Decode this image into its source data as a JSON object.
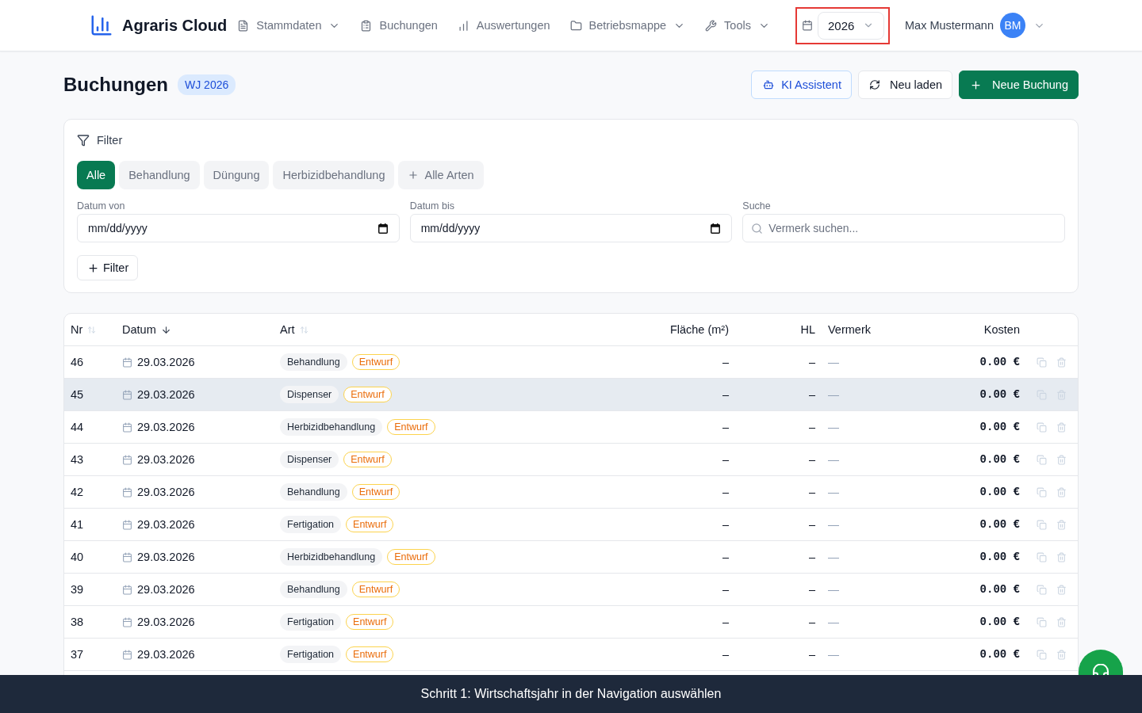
{
  "nav": {
    "app_name": "Agraris Cloud",
    "items": [
      {
        "label": "Stammdaten",
        "has_menu": true
      },
      {
        "label": "Buchungen",
        "has_menu": false
      },
      {
        "label": "Auswertungen",
        "has_menu": false
      },
      {
        "label": "Betriebsmappe",
        "has_menu": true
      },
      {
        "label": "Tools",
        "has_menu": true
      }
    ],
    "year_selector": {
      "value": "2026",
      "highlighted": true
    },
    "user": {
      "name": "Max Mustermann",
      "initials": "BM"
    }
  },
  "page_header": {
    "title": "Buchungen",
    "badge": "WJ 2026",
    "buttons": [
      {
        "label": "KI Assistent",
        "kind": "assistant"
      },
      {
        "label": "Neu laden",
        "kind": "reload"
      },
      {
        "label": "Neue Buchung",
        "kind": "primary"
      }
    ]
  },
  "filter": {
    "title": "Filter",
    "chips": [
      {
        "label": "Alle",
        "kind": "type",
        "selected": true
      },
      {
        "label": "Behandlung",
        "kind": "type",
        "selected": false
      },
      {
        "label": "Düngung",
        "kind": "type",
        "selected": false
      },
      {
        "label": "Herbizidbehandlung",
        "kind": "type",
        "selected": false
      },
      {
        "label": "Alle Arten",
        "kind": "more",
        "selected": false
      }
    ],
    "fields": [
      {
        "label": "Datum von",
        "kind": "date",
        "placeholder": "mm/dd/yyyy"
      },
      {
        "label": "Datum bis",
        "kind": "date",
        "placeholder": "mm/dd/yyyy"
      },
      {
        "label": "Suche",
        "kind": "search",
        "placeholder": "Vermerk suchen..."
      }
    ],
    "add_button": "Filter"
  },
  "table": {
    "columns": [
      {
        "label": "Nr",
        "sortable": true,
        "sorted": false
      },
      {
        "label": "Datum",
        "sortable": true,
        "sorted": true
      },
      {
        "label": "Art",
        "sortable": true,
        "sorted": false
      },
      {
        "label": "Fläche (m²)",
        "sortable": false,
        "sorted": false
      },
      {
        "label": "HL",
        "sortable": false,
        "sorted": false
      },
      {
        "label": "Vermerk",
        "sortable": false,
        "sorted": false
      },
      {
        "label": "Kosten",
        "sortable": false,
        "sorted": false
      }
    ],
    "rows": [
      {
        "nr": "46",
        "date": "29.03.2026",
        "type": "Behandlung",
        "status": "Entwurf",
        "area": "–",
        "hl": "–",
        "note": "—",
        "cost": "0.00 €",
        "highlighted": false
      },
      {
        "nr": "45",
        "date": "29.03.2026",
        "type": "Dispenser",
        "status": "Entwurf",
        "area": "–",
        "hl": "–",
        "note": "—",
        "cost": "0.00 €",
        "highlighted": true
      },
      {
        "nr": "44",
        "date": "29.03.2026",
        "type": "Herbizidbehandlung",
        "status": "Entwurf",
        "area": "–",
        "hl": "–",
        "note": "—",
        "cost": "0.00 €",
        "highlighted": false
      },
      {
        "nr": "43",
        "date": "29.03.2026",
        "type": "Dispenser",
        "status": "Entwurf",
        "area": "–",
        "hl": "–",
        "note": "—",
        "cost": "0.00 €",
        "highlighted": false
      },
      {
        "nr": "42",
        "date": "29.03.2026",
        "type": "Behandlung",
        "status": "Entwurf",
        "area": "–",
        "hl": "–",
        "note": "—",
        "cost": "0.00 €",
        "highlighted": false
      },
      {
        "nr": "41",
        "date": "29.03.2026",
        "type": "Fertigation",
        "status": "Entwurf",
        "area": "–",
        "hl": "–",
        "note": "—",
        "cost": "0.00 €",
        "highlighted": false
      },
      {
        "nr": "40",
        "date": "29.03.2026",
        "type": "Herbizidbehandlung",
        "status": "Entwurf",
        "area": "–",
        "hl": "–",
        "note": "—",
        "cost": "0.00 €",
        "highlighted": false
      },
      {
        "nr": "39",
        "date": "29.03.2026",
        "type": "Behandlung",
        "status": "Entwurf",
        "area": "–",
        "hl": "–",
        "note": "—",
        "cost": "0.00 €",
        "highlighted": false
      },
      {
        "nr": "38",
        "date": "29.03.2026",
        "type": "Fertigation",
        "status": "Entwurf",
        "area": "–",
        "hl": "–",
        "note": "—",
        "cost": "0.00 €",
        "highlighted": false
      },
      {
        "nr": "37",
        "date": "29.03.2026",
        "type": "Fertigation",
        "status": "Entwurf",
        "area": "–",
        "hl": "–",
        "note": "—",
        "cost": "0.00 €",
        "highlighted": false
      }
    ]
  },
  "guide_bar": {
    "text": "Schritt 1: Wirtschaftsjahr in der Navigation auswählen"
  }
}
